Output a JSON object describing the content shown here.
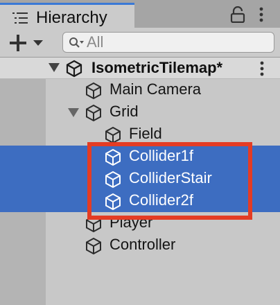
{
  "window": {
    "tab_title": "Hierarchy"
  },
  "toolbar": {
    "add_label": "+",
    "search_placeholder": "All"
  },
  "scene": {
    "title": "IsometricTilemap*"
  },
  "hierarchy": {
    "items": [
      {
        "label": "Main Camera",
        "depth": 1,
        "expanded": null,
        "selected": false
      },
      {
        "label": "Grid",
        "depth": 1,
        "expanded": true,
        "selected": false
      },
      {
        "label": "Field",
        "depth": 2,
        "expanded": null,
        "selected": false
      },
      {
        "label": "Collider1f",
        "depth": 2,
        "expanded": null,
        "selected": true
      },
      {
        "label": "ColliderStair",
        "depth": 2,
        "expanded": null,
        "selected": true
      },
      {
        "label": "Collider2f",
        "depth": 2,
        "expanded": null,
        "selected": true
      },
      {
        "label": "Player",
        "depth": 1,
        "expanded": null,
        "selected": false
      },
      {
        "label": "Controller",
        "depth": 1,
        "expanded": null,
        "selected": false
      }
    ]
  },
  "colors": {
    "selection": "#3d6dc1",
    "highlight_border": "#e43c24",
    "tab_accent": "#3a79d6"
  }
}
